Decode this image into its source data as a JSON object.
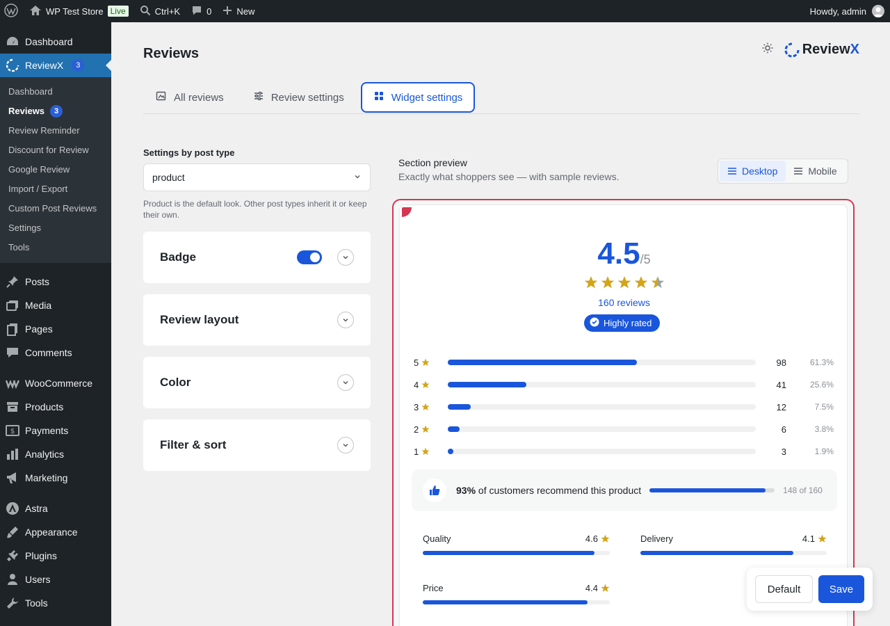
{
  "adminbar": {
    "site_name": "WP Test Store",
    "live_label": "Live",
    "search_shortcut": "Ctrl+K",
    "comments_count": "0",
    "new_label": "New",
    "howdy": "Howdy, admin"
  },
  "sidebar": {
    "dashboard": "Dashboard",
    "reviewx": "ReviewX",
    "reviewx_count": "3",
    "sub": [
      "Dashboard",
      "Reviews",
      "Review Reminder",
      "Discount for Review",
      "Google Review",
      "Import / Export",
      "Custom Post Reviews",
      "Settings",
      "Tools"
    ],
    "reviews_count": "3",
    "group2": [
      "Posts",
      "Media",
      "Pages",
      "Comments"
    ],
    "group3": [
      "WooCommerce",
      "Products",
      "Payments",
      "Analytics",
      "Marketing"
    ],
    "group4": [
      "Astra",
      "Appearance",
      "Plugins",
      "Users",
      "Tools"
    ]
  },
  "header": {
    "title": "Reviews",
    "brand_prefix": "Review",
    "brand_suffix": "X"
  },
  "tabs": [
    "All reviews",
    "Review settings",
    "Widget settings"
  ],
  "settings": {
    "post_type_label": "Settings by post type",
    "post_type_value": "product",
    "hint": "Product is the default look. Other post types inherit it or keep their own.",
    "sections": [
      "Badge",
      "Review layout",
      "Color",
      "Filter & sort"
    ],
    "badge_enabled": true
  },
  "preview": {
    "title": "Section preview",
    "subtitle": "Exactly what shoppers see — with sample reviews.",
    "devices": [
      "Desktop",
      "Mobile"
    ],
    "rating": "4.5",
    "rating_max": "/5",
    "rating_value": 4.5,
    "reviews_text": "160 reviews",
    "badge": "Highly rated",
    "distribution": [
      {
        "stars": "5",
        "count": "98",
        "pct": "61.3%",
        "fraction": 0.613
      },
      {
        "stars": "4",
        "count": "41",
        "pct": "25.6%",
        "fraction": 0.256
      },
      {
        "stars": "3",
        "count": "12",
        "pct": "7.5%",
        "fraction": 0.075
      },
      {
        "stars": "2",
        "count": "6",
        "pct": "3.8%",
        "fraction": 0.038
      },
      {
        "stars": "1",
        "count": "3",
        "pct": "1.9%",
        "fraction": 0.019
      }
    ],
    "recommend_pct": "93%",
    "recommend_text": " of customers recommend this product",
    "recommend_fraction": 0.925,
    "recommend_of": "148 of 160",
    "attributes": [
      {
        "name": "Quality",
        "value": "4.6",
        "score": 4.6
      },
      {
        "name": "Delivery",
        "value": "4.1",
        "score": 4.1
      },
      {
        "name": "Price",
        "value": "4.4",
        "score": 4.4
      }
    ]
  },
  "actions": {
    "default_label": "Default",
    "save_label": "Save"
  },
  "colors": {
    "accent": "#1a56db",
    "star": "#d4a514",
    "frame": "#d63654",
    "wp_dark": "#1d2327"
  }
}
